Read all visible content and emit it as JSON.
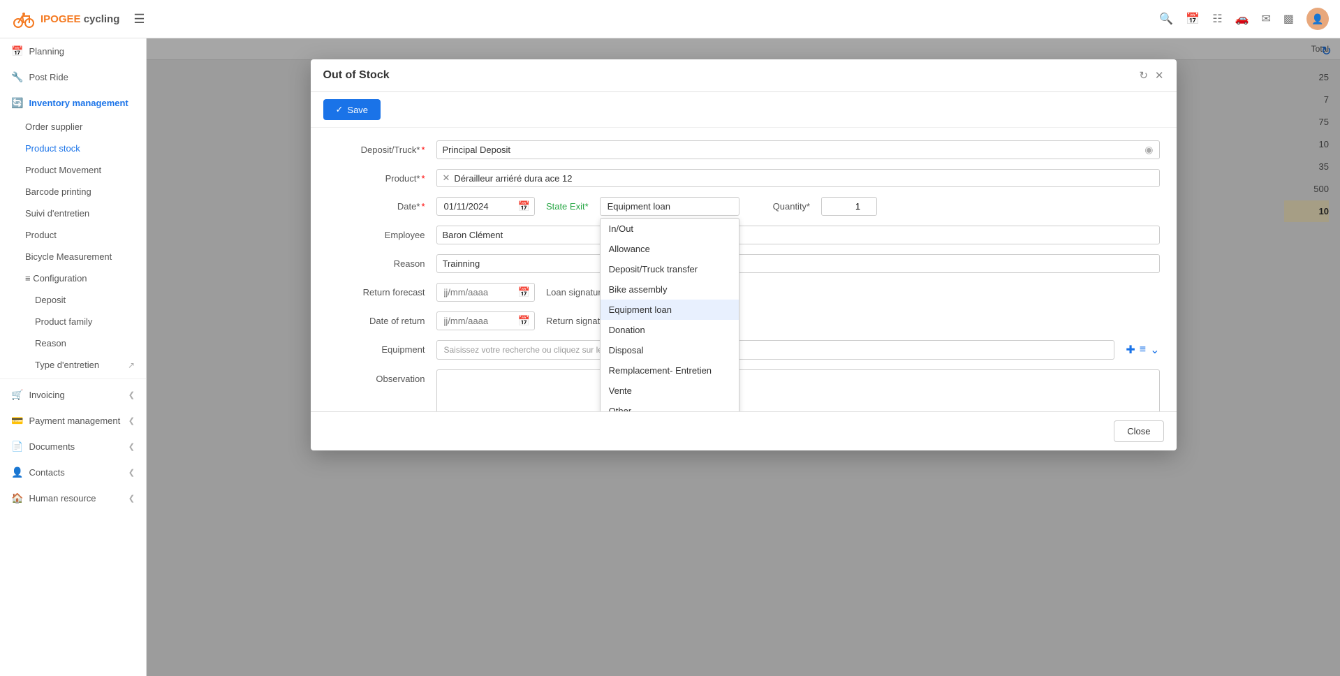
{
  "brand": {
    "name_part1": "IPOGEE",
    "name_part2": " cycling"
  },
  "navbar": {
    "icons": [
      "search-icon",
      "calendar-icon",
      "grid-icon",
      "car-icon",
      "mail-icon",
      "layout-icon",
      "user-icon"
    ]
  },
  "sidebar": {
    "items": [
      {
        "id": "planning",
        "label": "Planning",
        "icon": "📅",
        "active": false
      },
      {
        "id": "post-ride",
        "label": "Post Ride",
        "icon": "🔧",
        "active": false
      },
      {
        "id": "inventory",
        "label": "Inventory management",
        "icon": "📦",
        "active": true,
        "expanded": true
      },
      {
        "id": "order-supplier",
        "label": "Order supplier",
        "sub": true
      },
      {
        "id": "product-stock",
        "label": "Product stock",
        "sub": true,
        "active": true
      },
      {
        "id": "product-movement",
        "label": "Product Movement",
        "sub": true
      },
      {
        "id": "barcode-printing",
        "label": "Barcode printing",
        "sub": true
      },
      {
        "id": "suivi-entretien",
        "label": "Suivi d'entretien",
        "sub": true
      },
      {
        "id": "product",
        "label": "Product",
        "sub": true
      },
      {
        "id": "bicycle-measurement",
        "label": "Bicycle Measurement",
        "sub": true
      },
      {
        "id": "configuration",
        "label": "Configuration",
        "icon": "≡",
        "sub": true,
        "expanded": true
      },
      {
        "id": "deposit",
        "label": "Deposit",
        "subsub": true
      },
      {
        "id": "product-family",
        "label": "Product family",
        "subsub": true
      },
      {
        "id": "reason",
        "label": "Reason",
        "subsub": true
      },
      {
        "id": "type-entretien",
        "label": "Type d'entretien",
        "subsub": true
      },
      {
        "id": "invoicing",
        "label": "Invoicing",
        "icon": "🛒",
        "hasArrow": true
      },
      {
        "id": "payment-management",
        "label": "Payment management",
        "icon": "💳",
        "hasArrow": true
      },
      {
        "id": "documents",
        "label": "Documents",
        "icon": "📄",
        "hasArrow": true
      },
      {
        "id": "contacts",
        "label": "Contacts",
        "icon": "👤",
        "hasArrow": true
      },
      {
        "id": "human-resource",
        "label": "Human resource",
        "icon": "🏠",
        "hasArrow": true
      }
    ]
  },
  "main": {
    "table_header": "Total",
    "totals": [
      "25",
      "7",
      "75",
      "10",
      "35",
      "500",
      "10"
    ],
    "refresh_icon": "↻"
  },
  "modal": {
    "title": "Out of Stock",
    "save_button": "Save",
    "close_button": "Close",
    "fields": {
      "deposit_truck_label": "Deposit/Truck*",
      "deposit_truck_value": "Principal Deposit",
      "product_label": "Product*",
      "product_tag": "Dérailleur arriéré dura ace 12",
      "date_label": "Date*",
      "date_value": "01/11/2024",
      "state_exit_label": "State Exit*",
      "state_exit_value": "Equipment loan",
      "quantity_label": "Quantity*",
      "quantity_value": "1",
      "employee_label": "Employee",
      "employee_value": "Baron Clément",
      "reason_label": "Reason",
      "reason_value": "Trainning",
      "return_forecast_label": "Return forecast",
      "return_forecast_placeholder": "jj/mm/aaaa",
      "loan_signature_label": "Loan signature",
      "date_of_return_label": "Date of return",
      "date_of_return_placeholder": "jj/mm/aaaa",
      "return_signature_label": "Return signature",
      "equipment_label": "Equipment",
      "equipment_placeholder": "Saisissez votre recherche ou cliquez sur le bouton de droite.Les 50 premiers en",
      "observation_label": "Observation"
    },
    "dropdown_options": [
      {
        "value": "in_out",
        "label": "In/Out"
      },
      {
        "value": "allowance",
        "label": "Allowance"
      },
      {
        "value": "deposit_transfer",
        "label": "Deposit/Truck transfer"
      },
      {
        "value": "bike_assembly",
        "label": "Bike assembly"
      },
      {
        "value": "equipment_loan",
        "label": "Equipment loan",
        "selected": true
      },
      {
        "value": "donation",
        "label": "Donation"
      },
      {
        "value": "disposal",
        "label": "Disposal"
      },
      {
        "value": "remplacement",
        "label": "Remplacement- Entretien"
      },
      {
        "value": "vente",
        "label": "Vente"
      },
      {
        "value": "other",
        "label": "Other"
      }
    ]
  }
}
